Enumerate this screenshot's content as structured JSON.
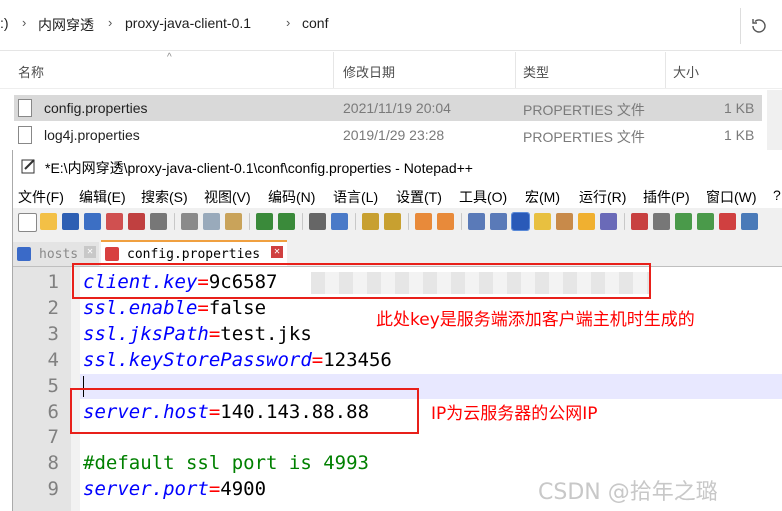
{
  "explorer": {
    "breadcrumb": [
      ":)",
      "内网穿透",
      "proxy-java-client-0.1",
      "conf"
    ],
    "columns": {
      "name": "名称",
      "modified": "修改日期",
      "type": "类型",
      "size": "大小"
    },
    "files": [
      {
        "name": "config.properties",
        "modified": "2021/11/19 20:04",
        "type": "PROPERTIES 文件",
        "size": "1 KB"
      },
      {
        "name": "log4j.properties",
        "modified": "2019/1/29 23:28",
        "type": "PROPERTIES 文件",
        "size": "1 KB"
      }
    ]
  },
  "npp": {
    "title": "*E:\\内网穿透\\proxy-java-client-0.1\\conf\\config.properties - Notepad++",
    "menu": [
      "文件(F)",
      "编辑(E)",
      "搜索(S)",
      "视图(V)",
      "编码(N)",
      "语言(L)",
      "设置(T)",
      "工具(O)",
      "宏(M)",
      "运行(R)",
      "插件(P)",
      "窗口(W)",
      "?"
    ],
    "tabs": [
      {
        "label": "hosts",
        "active": false
      },
      {
        "label": "config.properties",
        "active": true
      }
    ],
    "lines": [
      {
        "n": "1",
        "key": "client.key",
        "eq": "=",
        "val": "9c6587"
      },
      {
        "n": "2",
        "key": "ssl.enable",
        "eq": "=",
        "val": "false"
      },
      {
        "n": "3",
        "key": "ssl.jksPath",
        "eq": "=",
        "val": "test.jks"
      },
      {
        "n": "4",
        "key": "ssl.keyStorePassword",
        "eq": "=",
        "val": "123456"
      },
      {
        "n": "5",
        "key": "",
        "eq": "",
        "val": ""
      },
      {
        "n": "6",
        "key": "server.host",
        "eq": "=",
        "val": "140.143.88.88"
      },
      {
        "n": "7",
        "key": "",
        "eq": "",
        "val": ""
      },
      {
        "n": "8",
        "comment": "#default ssl port is 4993"
      },
      {
        "n": "9",
        "key": "server.port",
        "eq": "=",
        "val": "4900"
      }
    ]
  },
  "annotations": {
    "note1": "此处key是服务端添加客户端主机时生成的",
    "note2": "IP为云服务器的公网IP"
  },
  "watermark": "CSDN @拾年之璐",
  "colors": {
    "annotation": "#e8201a",
    "key": "#0000ff",
    "operator": "#ff0000",
    "comment": "#008000"
  }
}
